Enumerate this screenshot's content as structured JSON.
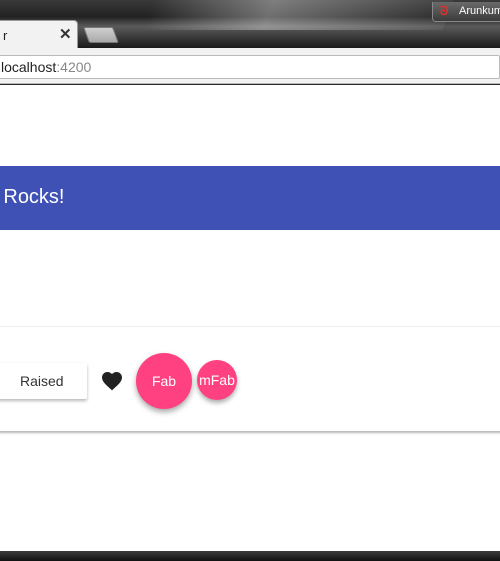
{
  "browser": {
    "profile_name": "Arunkumar",
    "profile_icon": "avatar-icon",
    "tab": {
      "title": "r",
      "close_glyph": "✕"
    },
    "address": {
      "host": "localhost",
      "port": ":4200"
    }
  },
  "app": {
    "toolbar_title": "esign Rocks!",
    "primary_color": "#3f51b5",
    "accent_color": "#ff4081"
  },
  "buttons": {
    "raised_label": "Raised",
    "icon_button_icon": "favorite-heart-icon",
    "fab_label": "Fab",
    "mini_fab_label": "mFab"
  }
}
